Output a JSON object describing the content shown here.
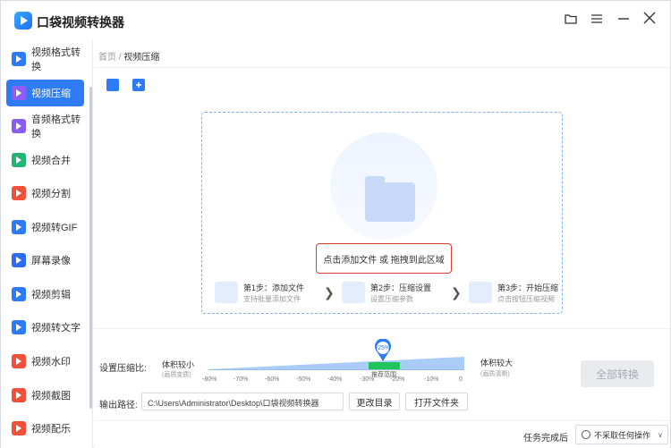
{
  "app": {
    "title": "口袋视频转换器"
  },
  "window_controls": {
    "folder_icon": "folder-icon",
    "menu_icon": "menu-icon",
    "minimize_icon": "minimize-icon",
    "close_icon": "close-icon"
  },
  "sidebar": {
    "items": [
      {
        "label": "视频格式转换",
        "color": "#2d7cf6",
        "active": false
      },
      {
        "label": "视频压缩",
        "color": "#8f5cf6",
        "active": true
      },
      {
        "label": "音频格式转换",
        "color": "#8a5cf2",
        "active": false
      },
      {
        "label": "视频合并",
        "color": "#22b573",
        "active": false
      },
      {
        "label": "视频分割",
        "color": "#f0513a",
        "active": false
      },
      {
        "label": "视频转GIF",
        "color": "#2d7cf6",
        "active": false
      },
      {
        "label": "屏幕录像",
        "color": "#2d6cf0",
        "active": false
      },
      {
        "label": "视频剪辑",
        "color": "#2d7cf6",
        "active": false
      },
      {
        "label": "视频转文字",
        "color": "#2d7cf6",
        "active": false
      },
      {
        "label": "视频水印",
        "color": "#f0513a",
        "active": false
      },
      {
        "label": "视频截图",
        "color": "#f0513a",
        "active": false
      },
      {
        "label": "视频配乐",
        "color": "#f0513a",
        "active": false
      }
    ]
  },
  "breadcrumb": {
    "home": "首页",
    "separator": " / ",
    "current": "视频压缩"
  },
  "dropzone": {
    "prompt": "点击添加文件  或  拖拽到此区域",
    "steps": [
      {
        "title": "第1步：添加文件",
        "subtitle": "支持批量添加文件"
      },
      {
        "title": "第2步：压缩设置",
        "subtitle": "设置压缩参数"
      },
      {
        "title": "第3步：开始压缩",
        "subtitle": "点击按钮压缩视频"
      }
    ]
  },
  "compression": {
    "label": "设置压缩比:",
    "left_title": "体积较小",
    "left_sub": "(画质变质)",
    "right_title": "体积较大",
    "right_sub": "(画质清晰)",
    "current_value": "-25%",
    "recommended_label": "推荐范围",
    "ticks": [
      "-80%",
      "-70%",
      "-60%",
      "-50%",
      "-40%",
      "-30%",
      "-20%",
      "-10%",
      "0"
    ]
  },
  "output": {
    "label": "输出路径:",
    "path": "C:\\Users\\Administrator\\Desktop\\口袋视频转换器",
    "change_dir": "更改目录",
    "open_folder": "打开文件夹"
  },
  "convert_all": "全部转换",
  "footer": {
    "label": "任务完成后",
    "option": "不采取任何操作"
  }
}
